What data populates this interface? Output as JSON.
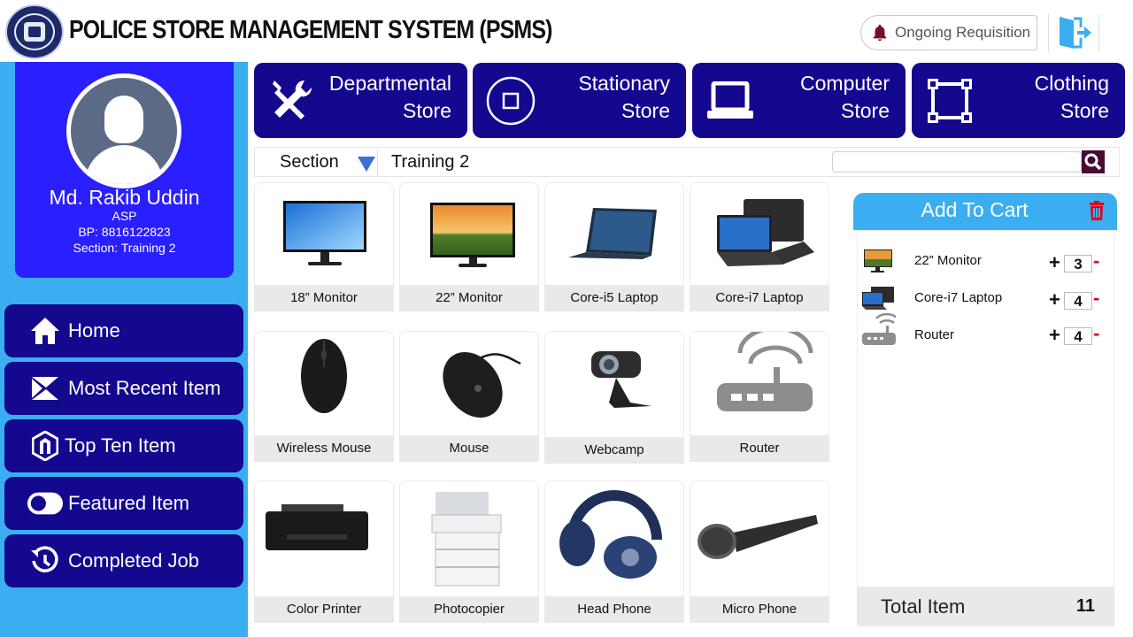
{
  "header": {
    "title": "POLICE STORE MANAGEMENT SYSTEM (PSMS)",
    "requisition_label": "Ongoing Requisition"
  },
  "profile": {
    "name": "Md. Rakib Uddin",
    "rank": "ASP",
    "bp": "BP: 8816122823",
    "section": "Section: Training 2"
  },
  "nav": [
    {
      "label": "Home",
      "icon": "home-icon"
    },
    {
      "label": "Most Recent Item",
      "icon": "recent-icon"
    },
    {
      "label": "Top Ten Item",
      "icon": "shield-icon"
    },
    {
      "label": "Featured Item",
      "icon": "toggle-icon"
    },
    {
      "label": "Completed Job",
      "icon": "history-icon"
    }
  ],
  "stores": [
    {
      "line1": "Departmental",
      "line2": "Store",
      "icon": "tools-icon"
    },
    {
      "line1": "Stationary",
      "line2": "Store",
      "icon": "stationary-icon"
    },
    {
      "line1": "Computer",
      "line2": "Store",
      "icon": "laptop-icon"
    },
    {
      "line1": "Clothing",
      "line2": "Store",
      "icon": "frame-icon"
    }
  ],
  "filter": {
    "section_label": "Section",
    "section_value": "Training 2",
    "search_placeholder": ""
  },
  "products": [
    {
      "name": "18” Monitor"
    },
    {
      "name": "22” Monitor"
    },
    {
      "name": "Core-i5 Laptop"
    },
    {
      "name": "Core-i7 Laptop"
    },
    {
      "name": "Wireless Mouse"
    },
    {
      "name": "Mouse"
    },
    {
      "name": "Webcamp"
    },
    {
      "name": "Router"
    },
    {
      "name": "Color Printer"
    },
    {
      "name": "Photocopier"
    },
    {
      "name": "Head Phone"
    },
    {
      "name": "Micro Phone"
    }
  ],
  "cart": {
    "title": "Add To Cart",
    "items": [
      {
        "name": "22” Monitor",
        "qty": "3"
      },
      {
        "name": "Core-i7 Laptop",
        "qty": "4"
      },
      {
        "name": "Router",
        "qty": "4"
      }
    ],
    "plus_label": "+",
    "minus_label": "-",
    "total_label": "Total Item",
    "total_value": "11"
  },
  "colors": {
    "navy": "#14088e",
    "profile_blue": "#2a1fff",
    "sky": "#3aaef0",
    "danger": "#e0001b"
  }
}
